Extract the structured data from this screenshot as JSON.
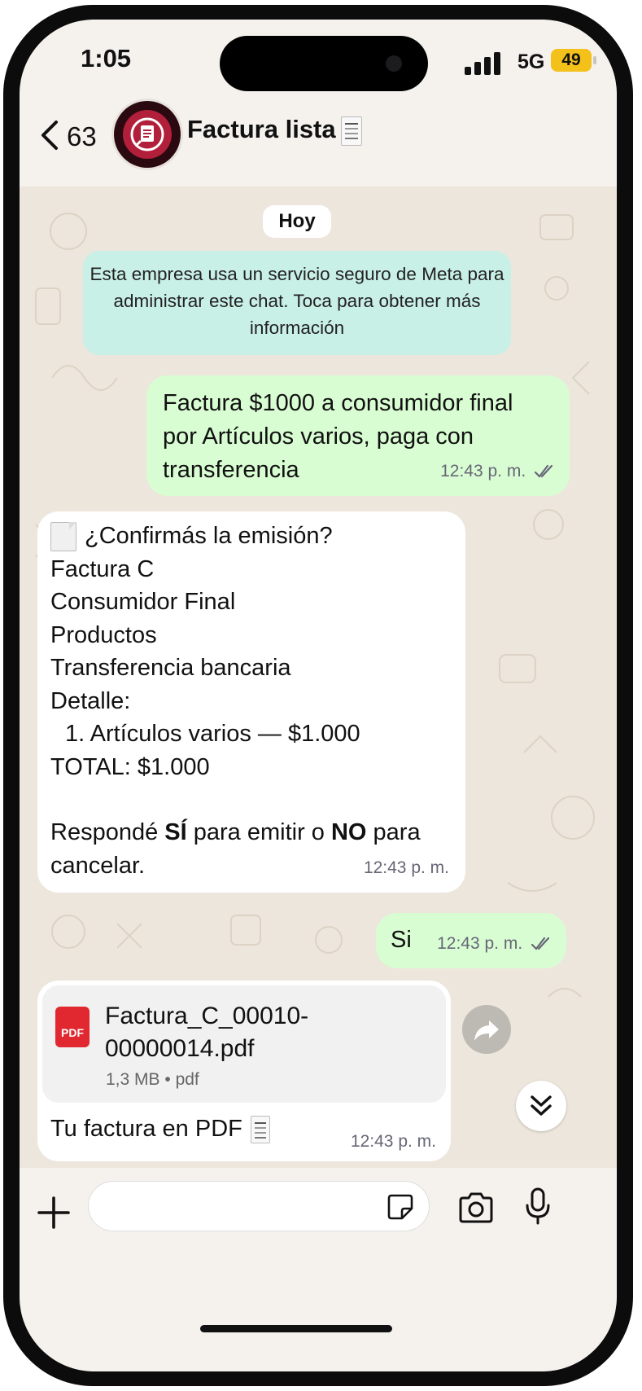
{
  "status_bar": {
    "time": "1:05",
    "network": "5G",
    "battery": "49"
  },
  "header": {
    "back_count": "63",
    "title": "Factura lista"
  },
  "chat": {
    "day_label": "Hoy",
    "system_notice": "Esta empresa usa un servicio seguro de Meta para administrar este chat. Toca para obtener más información",
    "messages": [
      {
        "direction": "outgoing",
        "text": "Factura $1000 a consumidor final por Artículos varios, paga con transferencia",
        "time": "12:43 p. m."
      },
      {
        "direction": "incoming",
        "lines": [
          "¿Confirmás la emisión?",
          "Factura C",
          "Consumidor Final",
          "Productos",
          "Transferencia bancaria",
          "Detalle:",
          "1. Artículos varios — $1.000",
          "TOTAL: $1.000"
        ],
        "reply_prefix": "Respondé",
        "reply_yes": "SÍ",
        "reply_middle": "para emitir o",
        "reply_no": "NO",
        "reply_suffix": "para cancelar.",
        "time": "12:43 p. m."
      },
      {
        "direction": "outgoing",
        "text": "Si",
        "time": "12:43 p. m."
      },
      {
        "direction": "incoming",
        "document": {
          "icon_label": "PDF",
          "file_name": "Factura_C_00010-00000014.pdf",
          "size": "1,3 MB",
          "file_type": "pdf"
        },
        "caption": "Tu factura en PDF",
        "time": "12:43 p. m."
      }
    ]
  },
  "icons": {
    "back": "chevron-left-icon",
    "read_receipt": "double-check-icon",
    "forward": "forward-icon",
    "scroll_down": "double-chevron-down-icon",
    "attach": "plus-icon",
    "sticker": "sticker-icon",
    "camera": "camera-icon",
    "microphone": "microphone-icon"
  },
  "colors": {
    "outgoing_bubble": "#d9fdd3",
    "incoming_bubble": "#ffffff",
    "system_notice": "#c9f0e6",
    "chat_background": "#ece6dc",
    "battery": "#f4c01a",
    "pdf_badge": "#e1272f"
  }
}
